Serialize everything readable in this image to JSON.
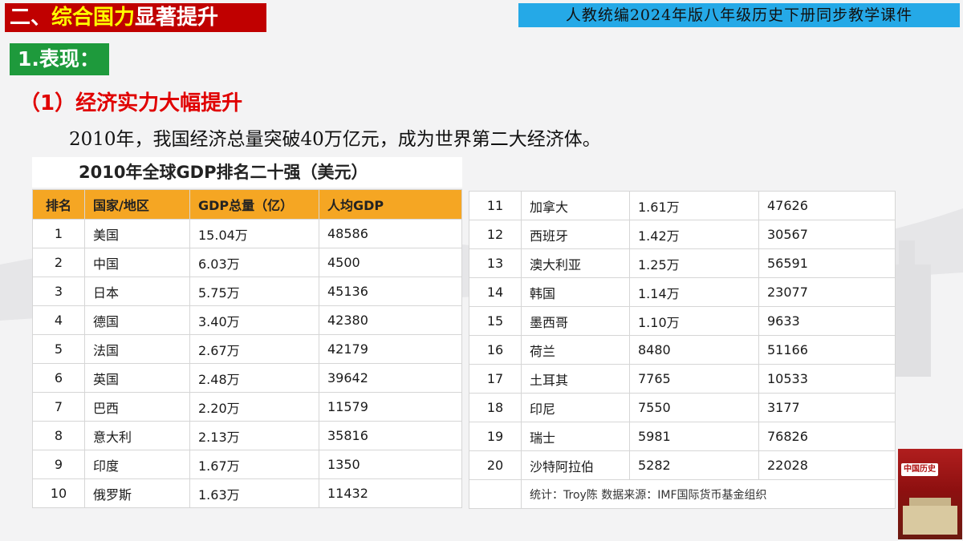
{
  "header": {
    "section_prefix": "二、",
    "section_highlight": "综合国力",
    "section_rest": "显著提升",
    "course_label": "人教统编2024年版八年级历史下册同步教学课件"
  },
  "sub_heading": "1.表现：",
  "point_heading": "（1）经济实力大幅提升",
  "sentence": "2010年，我国经济总量突破40万亿元，成为世界第二大经济体。",
  "table": {
    "title": "2010年全球GDP排名二十强（美元）",
    "columns": [
      "排名",
      "国家/地区",
      "GDP总量（亿）",
      "人均GDP"
    ],
    "rows_left": [
      [
        "1",
        "美国",
        "15.04万",
        "48586"
      ],
      [
        "2",
        "中国",
        "6.03万",
        "4500"
      ],
      [
        "3",
        "日本",
        "5.75万",
        "45136"
      ],
      [
        "4",
        "德国",
        "3.40万",
        "42380"
      ],
      [
        "5",
        "法国",
        "2.67万",
        "42179"
      ],
      [
        "6",
        "英国",
        "2.48万",
        "39642"
      ],
      [
        "7",
        "巴西",
        "2.20万",
        "11579"
      ],
      [
        "8",
        "意大利",
        "2.13万",
        "35816"
      ],
      [
        "9",
        "印度",
        "1.67万",
        "1350"
      ],
      [
        "10",
        "俄罗斯",
        "1.63万",
        "11432"
      ]
    ],
    "rows_right": [
      [
        "11",
        "加拿大",
        "1.61万",
        "47626"
      ],
      [
        "12",
        "西班牙",
        "1.42万",
        "30567"
      ],
      [
        "13",
        "澳大利亚",
        "1.25万",
        "56591"
      ],
      [
        "14",
        "韩国",
        "1.14万",
        "23077"
      ],
      [
        "15",
        "墨西哥",
        "1.10万",
        "9633"
      ],
      [
        "16",
        "荷兰",
        "8480",
        "51166"
      ],
      [
        "17",
        "土耳其",
        "7765",
        "10533"
      ],
      [
        "18",
        "印尼",
        "7550",
        "3177"
      ],
      [
        "19",
        "瑞士",
        "5981",
        "76826"
      ],
      [
        "20",
        "沙特阿拉伯",
        "5282",
        "22028"
      ]
    ],
    "footer": "统计：Troy陈 数据来源：IMF国际货币基金组织"
  },
  "book": {
    "title": "中国历史"
  },
  "colors": {
    "red": "#c00000",
    "green": "#1e9a3c",
    "blue": "#25a9e7",
    "orange": "#f5a623"
  }
}
